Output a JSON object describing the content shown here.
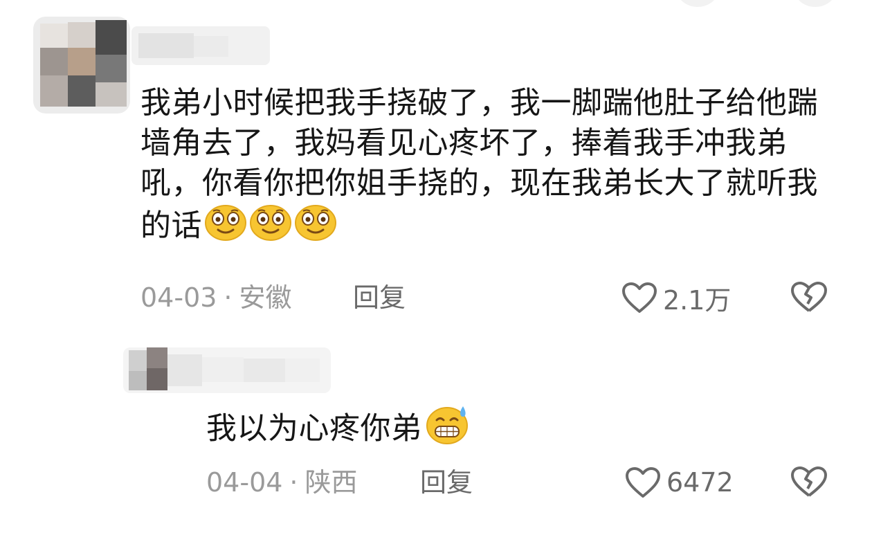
{
  "comments": [
    {
      "text": "我弟小时候把我手挠破了，我一脚踹他肚子给他踹墙角去了，我妈看见心疼坏了，捧着我手冲我弟吼，你看你把你姐手挠的，现在我弟长大了就听我的话",
      "emoji_icons": [
        "grin-smiley-icon",
        "grin-smiley-icon",
        "grin-smiley-icon"
      ],
      "date": "04-03",
      "location": "安徽",
      "reply_label": "回复",
      "likes": "2.1万"
    },
    {
      "text": "我以为心疼你弟",
      "emoji_icons": [
        "sweat-grin-icon"
      ],
      "date": "04-04",
      "location": "陕西",
      "reply_label": "回复",
      "likes": "6472"
    }
  ],
  "meta_separator": "·",
  "colors": {
    "text": "#161616",
    "meta": "#9a9a9a",
    "action": "#6a6a6a",
    "emoji": "#f7c531"
  },
  "icons": {
    "like": "heart-outline-icon",
    "dislike": "broken-heart-icon"
  }
}
